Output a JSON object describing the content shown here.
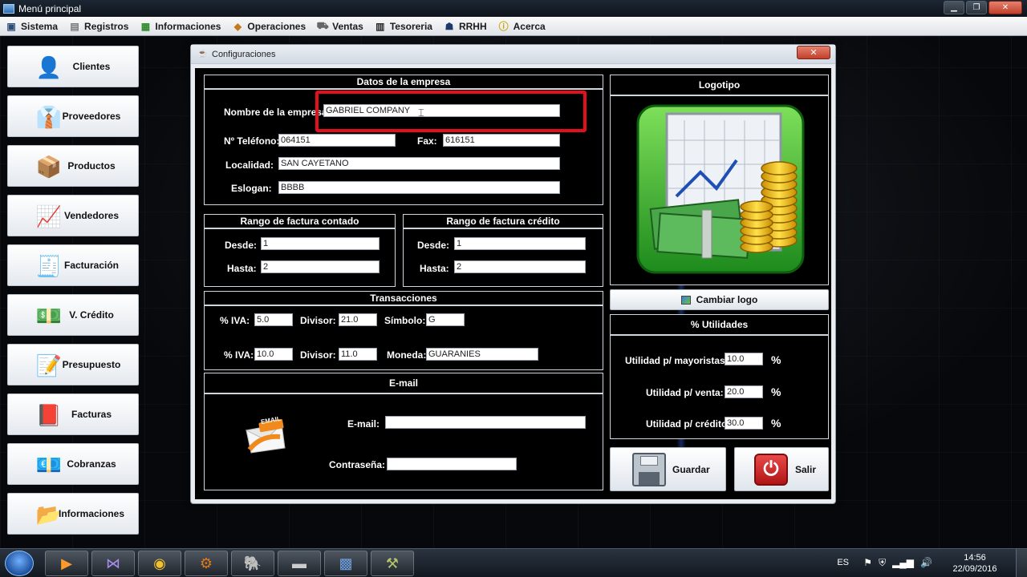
{
  "window": {
    "title": "Menú principal"
  },
  "menu": [
    {
      "label": "Sistema",
      "icon": "computer-icon"
    },
    {
      "label": "Registros",
      "icon": "document-icon"
    },
    {
      "label": "Informaciones",
      "icon": "grid-icon"
    },
    {
      "label": "Operaciones",
      "icon": "box-icon"
    },
    {
      "label": "Ventas",
      "icon": "cart-icon"
    },
    {
      "label": "Tesoreria",
      "icon": "book-icon"
    },
    {
      "label": "RRHH",
      "icon": "people-icon"
    },
    {
      "label": "Acerca",
      "icon": "info-icon"
    }
  ],
  "sidebar": [
    {
      "label": "Clientes"
    },
    {
      "label": "Proveedores"
    },
    {
      "label": "Productos"
    },
    {
      "label": "Vendedores"
    },
    {
      "label": "Facturación"
    },
    {
      "label": "V. Crédito"
    },
    {
      "label": "Presupuesto"
    },
    {
      "label": "Facturas"
    },
    {
      "label": "Cobranzas"
    },
    {
      "label": "Informaciones"
    }
  ],
  "dialog": {
    "title": "Configuraciones",
    "company": {
      "header": "Datos de la empresa",
      "name_label": "Nombre de la empresa:",
      "name_value": "GABRIEL COMPANY",
      "phone_label": "Nº Teléfono:",
      "phone_value": "064151",
      "fax_label": "Fax:",
      "fax_value": "616151",
      "city_label": "Localidad:",
      "city_value": "SAN CAYETANO",
      "slogan_label": "Eslogan:",
      "slogan_value": "BBBB"
    },
    "cash_range": {
      "header": "Rango de factura contado",
      "from_label": "Desde:",
      "from_value": "1",
      "to_label": "Hasta:",
      "to_value": "2"
    },
    "credit_range": {
      "header": "Rango de factura crédito",
      "from_label": "Desde:",
      "from_value": "1",
      "to_label": "Hasta:",
      "to_value": "2"
    },
    "transactions": {
      "header": "Transacciones",
      "iva1_label": "% IVA:",
      "iva1_value": "5.0",
      "div1_label": "Divisor:",
      "div1_value": "21.0",
      "symbol_label": "Símbolo:",
      "symbol_value": "G",
      "iva2_label": "% IVA:",
      "iva2_value": "10.0",
      "div2_label": "Divisor:",
      "div2_value": "11.0",
      "currency_label": "Moneda:",
      "currency_value": "GUARANIES"
    },
    "email": {
      "header": "E-mail",
      "email_label": "E-mail:",
      "email_value": "",
      "password_label": "Contraseña:",
      "password_value": "",
      "badge": "EMAIL"
    },
    "logo": {
      "header": "Logotipo",
      "change_button": "Cambiar logo"
    },
    "profit": {
      "header": "% Utilidades",
      "wholesale_label": "Utilidad p/ mayoristas:",
      "wholesale_value": "10.0",
      "sale_label": "Utilidad p/ venta:",
      "sale_value": "20.0",
      "credit_label": "Utilidad p/ crédito:",
      "credit_value": "30.0",
      "percent": "%"
    },
    "save_button": "Guardar",
    "exit_button": "Salir"
  },
  "taskbar": {
    "lang": "ES",
    "time": "14:56",
    "date": "22/09/2016",
    "items": [
      "media-player-icon",
      "visual-studio-icon",
      "chrome-icon",
      "java-ide-icon",
      "database-icon",
      "app-icon",
      "network-icon",
      "tool-icon"
    ]
  }
}
